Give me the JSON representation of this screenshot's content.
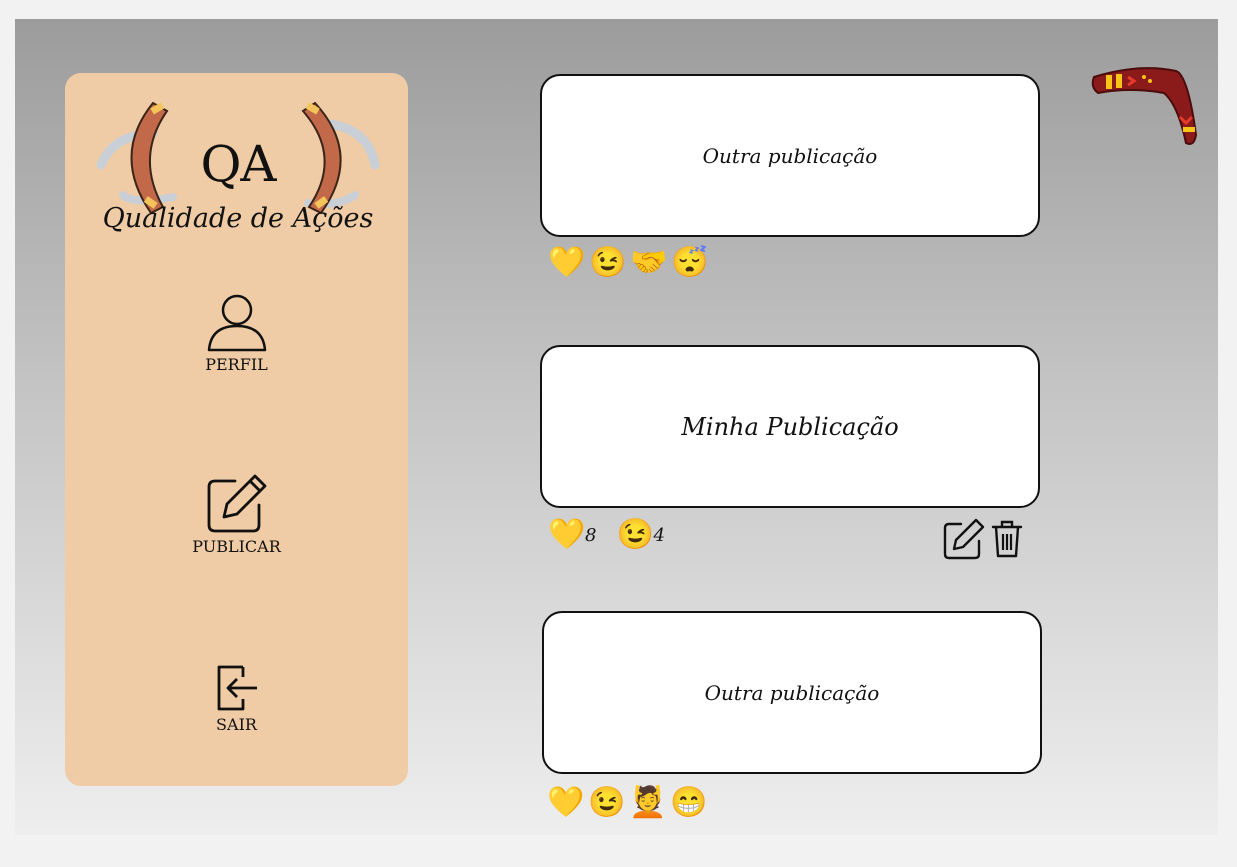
{
  "brand": {
    "logo_letters": "QA",
    "tagline": "Qualidade de Ações"
  },
  "sidebar": {
    "items": [
      {
        "label": "PERFIL",
        "icon": "user-icon"
      },
      {
        "label": "PUBLICAR",
        "icon": "edit-square-icon"
      },
      {
        "label": "SAIR",
        "icon": "logout-icon"
      }
    ]
  },
  "feed": {
    "posts": [
      {
        "text": "Outra publicação",
        "reactions": [
          "💛",
          "😉",
          "🤝",
          "😴"
        ]
      },
      {
        "text": "Minha Publicação",
        "reactions": [
          {
            "emoji": "💛",
            "count": "8"
          },
          {
            "emoji": "😉",
            "count": "4"
          }
        ],
        "actions": [
          "edit-icon",
          "trash-icon"
        ]
      },
      {
        "text": "Outra publicação",
        "reactions": [
          "💛",
          "😉",
          "💆",
          "😁"
        ]
      }
    ]
  },
  "colors": {
    "sidebar_bg": "#efcca5",
    "boomerang": "#8b1a1a",
    "accent_yellow": "#f5c518"
  }
}
